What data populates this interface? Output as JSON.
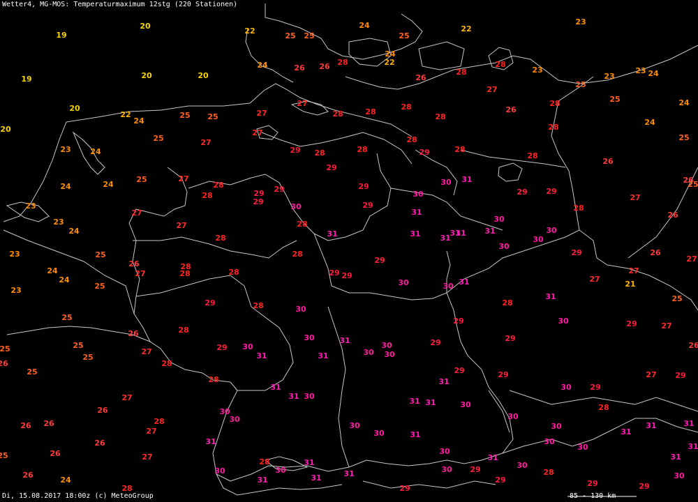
{
  "header": {
    "title": "Wetter4, MG-MOS: Temperaturmaximum 12stg (220 Stationen)"
  },
  "footer": {
    "timestamp": "Di, 15.08.2017 18:00z (c) MeteoGroup"
  },
  "scale_bar": {
    "label": "85 - 130 km"
  },
  "colors": {
    "19": "#f7d300",
    "20": "#f7d300",
    "21": "#ffb400",
    "22": "#ffb400",
    "23": "#ff8c00",
    "24": "#ff8c00",
    "25": "#ff6020",
    "26": "#ff3a3a",
    "27": "#ff2a2a",
    "28": "#ff2222",
    "29": "#ff1c3c",
    "30": "#ff1aa0",
    "31": "#ff1ab4",
    "background": "#000000",
    "borders": "#c8c8c8"
  },
  "stations": [
    [
      "19",
      88,
      50
    ],
    [
      "20",
      208,
      37
    ],
    [
      "19",
      38,
      113
    ],
    [
      "20",
      210,
      108
    ],
    [
      "20",
      291,
      108
    ],
    [
      "20",
      107,
      155
    ],
    [
      "20",
      8,
      185
    ],
    [
      "22",
      358,
      44
    ],
    [
      "25",
      416,
      51
    ],
    [
      "25",
      443,
      51
    ],
    [
      "24",
      522,
      36
    ],
    [
      "25",
      579,
      51
    ],
    [
      "22",
      668,
      41
    ],
    [
      "23",
      832,
      31
    ],
    [
      "24",
      376,
      93
    ],
    [
      "26",
      429,
      97
    ],
    [
      "26",
      465,
      95
    ],
    [
      "28",
      491,
      89
    ],
    [
      "24",
      559,
      77
    ],
    [
      "22",
      558,
      89
    ],
    [
      "28",
      717,
      92
    ],
    [
      "26",
      603,
      111
    ],
    [
      "28",
      661,
      103
    ],
    [
      "23",
      770,
      100
    ],
    [
      "23",
      873,
      109
    ],
    [
      "23",
      918,
      101
    ],
    [
      "24",
      936,
      105
    ],
    [
      "27",
      705,
      128
    ],
    [
      "25",
      832,
      121
    ],
    [
      "25",
      881,
      142
    ],
    [
      "24",
      980,
      147
    ],
    [
      "22",
      180,
      164
    ],
    [
      "24",
      199,
      173
    ],
    [
      "25",
      265,
      165
    ],
    [
      "25",
      305,
      167
    ],
    [
      "27",
      375,
      162
    ],
    [
      "27",
      433,
      148
    ],
    [
      "28",
      484,
      163
    ],
    [
      "28",
      531,
      160
    ],
    [
      "28",
      582,
      153
    ],
    [
      "28",
      631,
      167
    ],
    [
      "26",
      732,
      157
    ],
    [
      "28",
      795,
      148
    ],
    [
      "28",
      793,
      182
    ],
    [
      "24",
      931,
      175
    ],
    [
      "25",
      980,
      197
    ],
    [
      "23",
      94,
      214
    ],
    [
      "24",
      137,
      217
    ],
    [
      "25",
      227,
      198
    ],
    [
      "27",
      295,
      204
    ],
    [
      "27",
      369,
      190
    ],
    [
      "29",
      423,
      215
    ],
    [
      "28",
      458,
      219
    ],
    [
      "28",
      519,
      214
    ],
    [
      "28",
      590,
      200
    ],
    [
      "29",
      608,
      218
    ],
    [
      "28",
      659,
      214
    ],
    [
      "28",
      763,
      223
    ],
    [
      "26",
      871,
      231
    ],
    [
      "25",
      203,
      257
    ],
    [
      "27",
      263,
      256
    ],
    [
      "24",
      94,
      267
    ],
    [
      "24",
      155,
      264
    ],
    [
      "28",
      313,
      265
    ],
    [
      "29",
      475,
      240
    ],
    [
      "29",
      521,
      267
    ],
    [
      "30",
      639,
      261
    ],
    [
      "31",
      669,
      257
    ],
    [
      "29",
      748,
      275
    ],
    [
      "29",
      790,
      274
    ],
    [
      "26",
      986,
      258
    ],
    [
      "25",
      993,
      264
    ],
    [
      "23",
      44,
      295
    ],
    [
      "28",
      297,
      280
    ],
    [
      "29",
      371,
      277
    ],
    [
      "29",
      370,
      289
    ],
    [
      "29",
      400,
      271
    ],
    [
      "30",
      424,
      296
    ],
    [
      "29",
      527,
      294
    ],
    [
      "30",
      599,
      278
    ],
    [
      "28",
      829,
      298
    ],
    [
      "27",
      910,
      283
    ],
    [
      "26",
      964,
      308
    ],
    [
      "27",
      196,
      305
    ],
    [
      "23",
      84,
      318
    ],
    [
      "24",
      106,
      331
    ],
    [
      "27",
      260,
      323
    ],
    [
      "28",
      316,
      341
    ],
    [
      "28",
      433,
      321
    ],
    [
      "31",
      476,
      335
    ],
    [
      "31",
      597,
      304
    ],
    [
      "31",
      595,
      335
    ],
    [
      "30",
      715,
      314
    ],
    [
      "31",
      702,
      331
    ],
    [
      "31",
      638,
      341
    ],
    [
      "31",
      652,
      334
    ],
    [
      "31",
      660,
      334
    ],
    [
      "30",
      790,
      330
    ],
    [
      "30",
      771,
      343
    ],
    [
      "30",
      722,
      353
    ],
    [
      "29",
      826,
      362
    ],
    [
      "26",
      939,
      362
    ],
    [
      "27",
      991,
      371
    ],
    [
      "23",
      21,
      364
    ],
    [
      "25",
      144,
      365
    ],
    [
      "26",
      192,
      378
    ],
    [
      "27",
      201,
      392
    ],
    [
      "28",
      266,
      382
    ],
    [
      "28",
      265,
      392
    ],
    [
      "28",
      335,
      390
    ],
    [
      "28",
      426,
      364
    ],
    [
      "29",
      544,
      373
    ],
    [
      "29",
      479,
      391
    ],
    [
      "29",
      497,
      395
    ],
    [
      "27",
      908,
      388
    ],
    [
      "27",
      852,
      400
    ],
    [
      "21",
      903,
      407
    ],
    [
      "24",
      75,
      388
    ],
    [
      "24",
      92,
      401
    ],
    [
      "25",
      143,
      410
    ],
    [
      "23",
      23,
      416
    ],
    [
      "30",
      578,
      405
    ],
    [
      "30",
      642,
      410
    ],
    [
      "31",
      665,
      404
    ],
    [
      "29",
      301,
      434
    ],
    [
      "28",
      370,
      438
    ],
    [
      "30",
      431,
      443
    ],
    [
      "28",
      727,
      434
    ],
    [
      "31",
      789,
      425
    ],
    [
      "25",
      970,
      428
    ],
    [
      "25",
      96,
      455
    ],
    [
      "26",
      191,
      478
    ],
    [
      "28",
      263,
      473
    ],
    [
      "30",
      443,
      484
    ],
    [
      "31",
      494,
      488
    ],
    [
      "30",
      554,
      495
    ],
    [
      "29",
      624,
      491
    ],
    [
      "29",
      657,
      460
    ],
    [
      "30",
      807,
      460
    ],
    [
      "29",
      905,
      464
    ],
    [
      "27",
      955,
      467
    ],
    [
      "29",
      731,
      485
    ],
    [
      "25",
      112,
      495
    ],
    [
      "25",
      7,
      500
    ],
    [
      "27",
      210,
      504
    ],
    [
      "29",
      318,
      498
    ],
    [
      "30",
      355,
      497
    ],
    [
      "31",
      375,
      510
    ],
    [
      "31",
      463,
      510
    ],
    [
      "30",
      528,
      505
    ],
    [
      "30",
      558,
      508
    ],
    [
      "26",
      994,
      495
    ],
    [
      "26",
      4,
      521
    ],
    [
      "25",
      126,
      512
    ],
    [
      "25",
      46,
      533
    ],
    [
      "28",
      239,
      521
    ],
    [
      "28",
      306,
      544
    ],
    [
      "29",
      658,
      531
    ],
    [
      "31",
      636,
      547
    ],
    [
      "29",
      721,
      537
    ],
    [
      "27",
      933,
      537
    ],
    [
      "29",
      975,
      538
    ],
    [
      "31",
      395,
      555
    ],
    [
      "31",
      421,
      568
    ],
    [
      "30",
      443,
      568
    ],
    [
      "27",
      182,
      570
    ],
    [
      "29",
      853,
      555
    ],
    [
      "30",
      811,
      555
    ],
    [
      "31",
      594,
      575
    ],
    [
      "31",
      617,
      577
    ],
    [
      "30",
      667,
      580
    ],
    [
      "28",
      865,
      584
    ],
    [
      "26",
      147,
      588
    ],
    [
      "30",
      322,
      590
    ],
    [
      "30",
      336,
      601
    ],
    [
      "28",
      228,
      604
    ],
    [
      "27",
      217,
      618
    ],
    [
      "26",
      37,
      610
    ],
    [
      "26",
      70,
      607
    ],
    [
      "30",
      508,
      610
    ],
    [
      "30",
      543,
      621
    ],
    [
      "31",
      595,
      623
    ],
    [
      "30",
      735,
      597
    ],
    [
      "30",
      797,
      611
    ],
    [
      "31",
      897,
      619
    ],
    [
      "31",
      933,
      610
    ],
    [
      "31",
      987,
      607
    ],
    [
      "31",
      302,
      633
    ],
    [
      "26",
      143,
      635
    ],
    [
      "30",
      787,
      633
    ],
    [
      "30",
      835,
      641
    ],
    [
      "31",
      993,
      640
    ],
    [
      "25",
      4,
      653
    ],
    [
      "26",
      79,
      650
    ],
    [
      "27",
      211,
      655
    ],
    [
      "30",
      637,
      647
    ],
    [
      "31",
      706,
      656
    ],
    [
      "31",
      968,
      655
    ],
    [
      "28",
      379,
      662
    ],
    [
      "31",
      443,
      663
    ],
    [
      "30",
      315,
      675
    ],
    [
      "30",
      402,
      674
    ],
    [
      "31",
      500,
      679
    ],
    [
      "30",
      640,
      673
    ],
    [
      "29",
      681,
      673
    ],
    [
      "30",
      748,
      667
    ],
    [
      "28",
      786,
      677
    ],
    [
      "29",
      717,
      688
    ],
    [
      "26",
      40,
      681
    ],
    [
      "24",
      94,
      688
    ],
    [
      "31",
      376,
      688
    ],
    [
      "31",
      453,
      685
    ],
    [
      "30",
      973,
      682
    ],
    [
      "28",
      182,
      700
    ],
    [
      "29",
      580,
      700
    ],
    [
      "29",
      849,
      693
    ],
    [
      "29",
      923,
      697
    ]
  ]
}
